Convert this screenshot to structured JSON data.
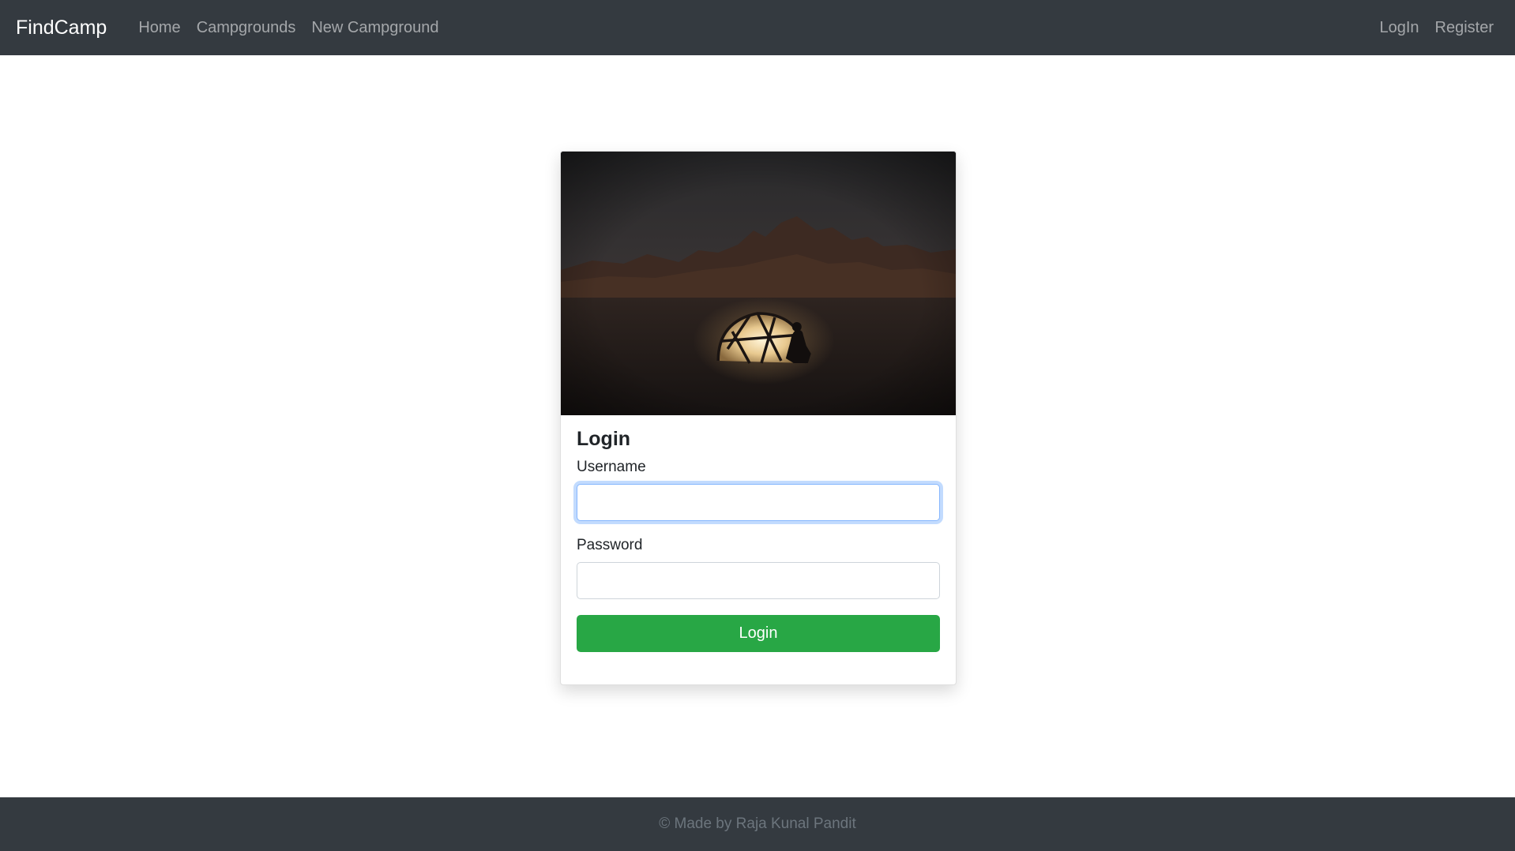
{
  "navbar": {
    "brand": "FindCamp",
    "links": [
      "Home",
      "Campgrounds",
      "New Campground"
    ],
    "auth_links": [
      "LogIn",
      "Register"
    ]
  },
  "login_card": {
    "image_alt": "tent-glowing-at-night-desert",
    "title": "Login",
    "username_label": "Username",
    "username_value": "",
    "password_label": "Password",
    "password_value": "",
    "submit_label": "Login"
  },
  "footer": {
    "text": "© Made by Raja Kunal Pandit"
  },
  "colors": {
    "navbar_bg": "#343a40",
    "button_success": "#28a745",
    "focus_border": "#86b7fe"
  }
}
